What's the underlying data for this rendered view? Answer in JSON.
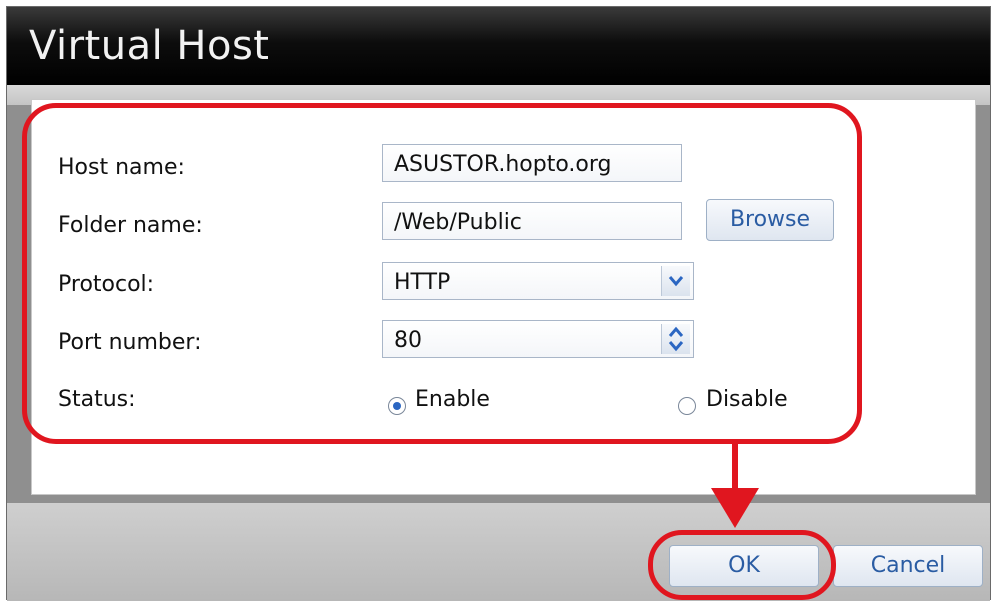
{
  "dialog": {
    "title": "Virtual Host"
  },
  "form": {
    "host_name": {
      "label": "Host name:",
      "value": "ASUSTOR.hopto.org"
    },
    "folder_name": {
      "label": "Folder name:",
      "value": "/Web/Public",
      "browse_label": "Browse"
    },
    "protocol": {
      "label": "Protocol:",
      "value": "HTTP"
    },
    "port_number": {
      "label": "Port number:",
      "value": "80"
    },
    "status": {
      "label": "Status:",
      "enable_label": "Enable",
      "disable_label": "Disable",
      "selected": "Enable"
    }
  },
  "footer": {
    "ok_label": "OK",
    "cancel_label": "Cancel"
  },
  "annotation": {
    "highlight_color": "#e0161f"
  },
  "icons": {
    "dropdown": "chevron-down-icon",
    "stepper_up": "chevron-up-icon",
    "stepper_down": "chevron-down-icon"
  }
}
